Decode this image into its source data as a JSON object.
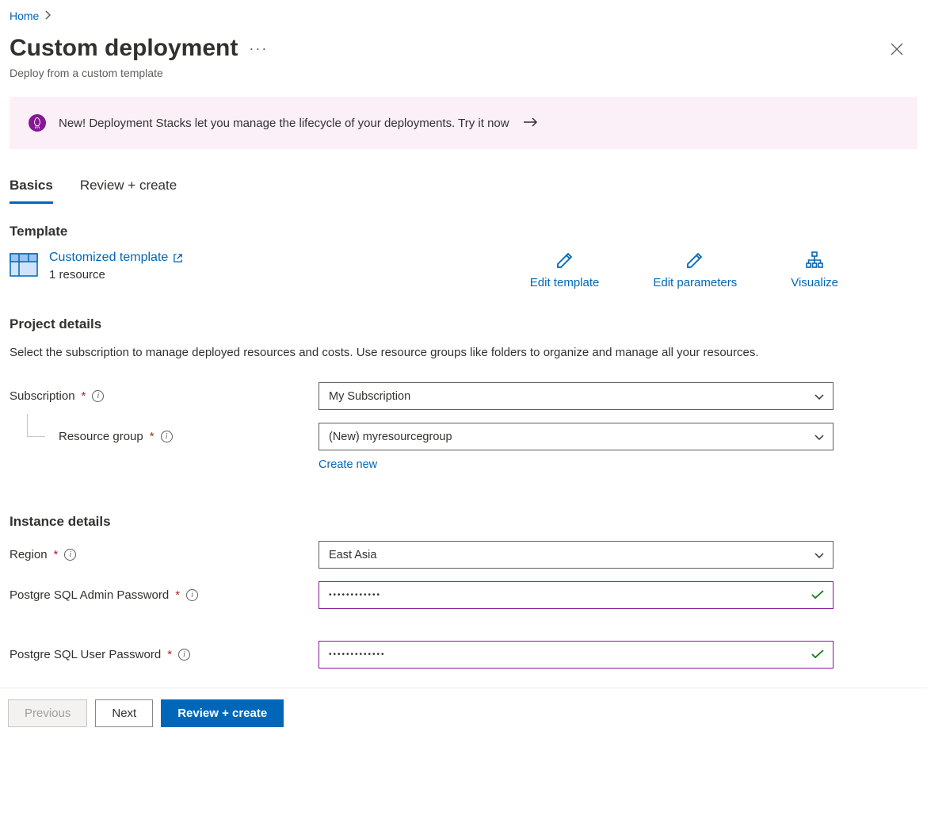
{
  "breadcrumb": {
    "home": "Home"
  },
  "header": {
    "title": "Custom deployment",
    "subtitle": "Deploy from a custom template"
  },
  "banner": {
    "text": "New! Deployment Stacks let you manage the lifecycle of your deployments. Try it now"
  },
  "tabs": {
    "basics": "Basics",
    "review": "Review + create"
  },
  "template": {
    "heading": "Template",
    "link_label": "Customized template",
    "resource_count": "1 resource",
    "edit_template": "Edit template",
    "edit_parameters": "Edit parameters",
    "visualize": "Visualize"
  },
  "project": {
    "heading": "Project details",
    "description": "Select the subscription to manage deployed resources and costs. Use resource groups like folders to organize and manage all your resources.",
    "subscription_label": "Subscription",
    "subscription_value": "My Subscription",
    "rg_label": "Resource group",
    "rg_value": "(New) myresourcegroup",
    "create_new": "Create new"
  },
  "instance": {
    "heading": "Instance details",
    "region_label": "Region",
    "region_value": "East Asia",
    "admin_pw_label": "Postgre SQL Admin Password",
    "admin_pw_value": "••••••••••••",
    "user_pw_label": "Postgre SQL User Password",
    "user_pw_value": "•••••••••••••"
  },
  "footer": {
    "previous": "Previous",
    "next": "Next",
    "review": "Review + create"
  }
}
